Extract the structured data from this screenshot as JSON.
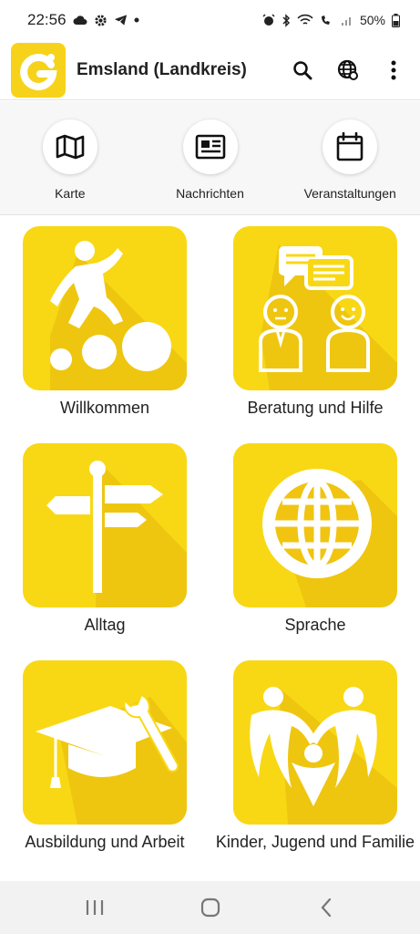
{
  "status_bar": {
    "time": "22:56",
    "battery": "50%",
    "left_icons": [
      "cloud-icon",
      "gear-icon",
      "telegram-icon",
      "dot-icon"
    ],
    "right_icons": [
      "alarm-icon",
      "bluetooth-icon",
      "wifi-icon",
      "wifi-call-icon",
      "signal-icon",
      "battery-icon"
    ]
  },
  "app_bar": {
    "title": "Emsland (Landkreis)",
    "logo_letter": "G",
    "actions": [
      "search-icon",
      "globe-icon",
      "more-vert-icon"
    ]
  },
  "quick_nav": [
    {
      "label": "Karte",
      "icon": "map-icon"
    },
    {
      "label": "Nachrichten",
      "icon": "newspaper-icon"
    },
    {
      "label": "Veranstaltungen",
      "icon": "calendar-icon"
    }
  ],
  "tiles": [
    {
      "label": "Willkommen",
      "icon": "person-jumping-icon"
    },
    {
      "label": "Beratung und Hilfe",
      "icon": "conversation-icon"
    },
    {
      "label": "Alltag",
      "icon": "signpost-icon"
    },
    {
      "label": "Sprache",
      "icon": "globe-icon"
    },
    {
      "label": "Ausbildung und Arbeit",
      "icon": "graduation-wrench-icon"
    },
    {
      "label": "Kinder, Jugend und Familie",
      "icon": "family-icon"
    }
  ],
  "nav_bar": [
    "recent-apps-icon",
    "home-icon",
    "back-icon"
  ],
  "colors": {
    "brand_yellow": "#f8d815",
    "tile_shadow": "#e2b70f",
    "text": "#222222"
  }
}
